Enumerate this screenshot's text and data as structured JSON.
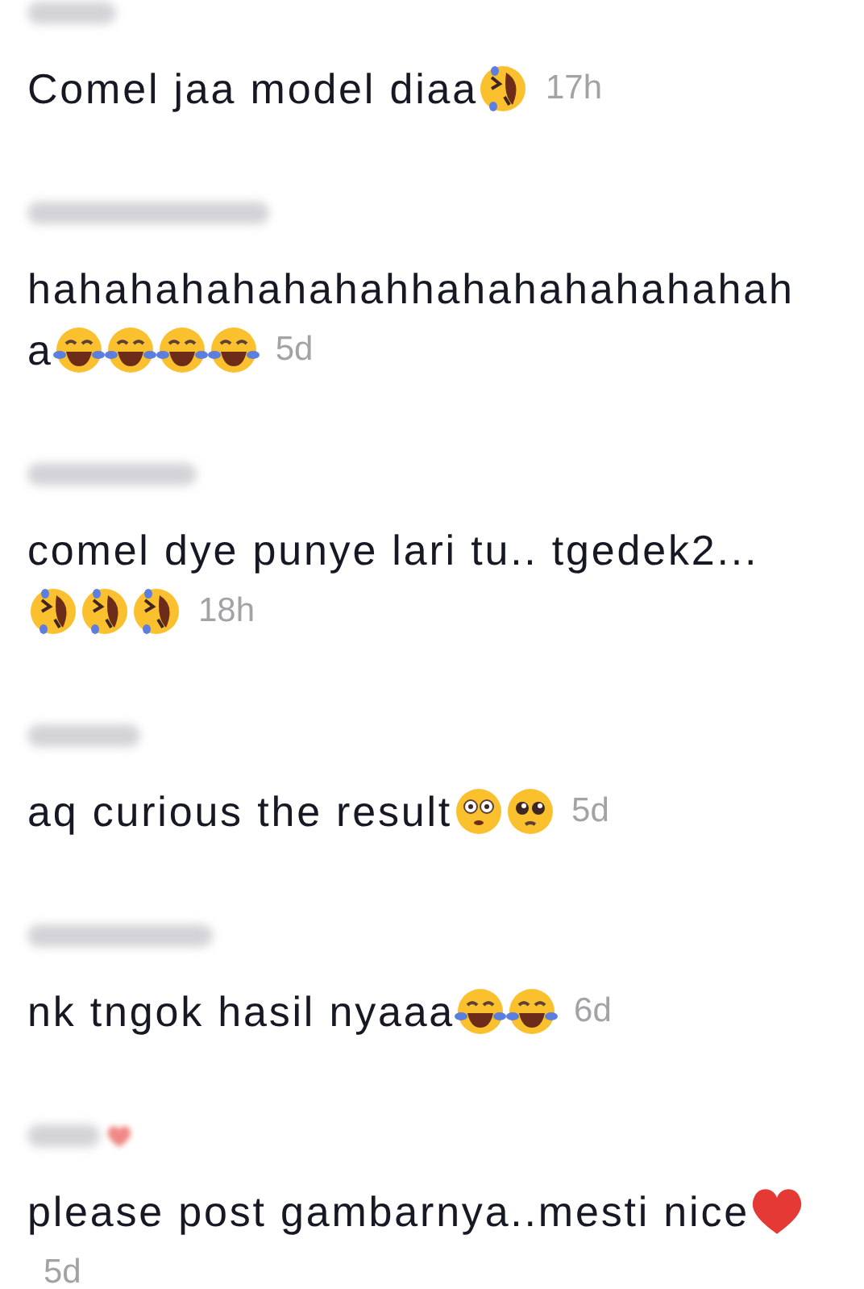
{
  "comments": [
    {
      "heart_in_name": false,
      "lines": [
        [
          {
            "kind": "text",
            "text": "Comel jaa model diaa"
          },
          {
            "kind": "rofl"
          },
          {
            "kind": "time",
            "text": "17h"
          }
        ]
      ]
    },
    {
      "heart_in_name": false,
      "lines": [
        [
          {
            "kind": "text",
            "text": "hahahahahahahahhahahahahahahah"
          }
        ],
        [
          {
            "kind": "text",
            "text": "a"
          },
          {
            "kind": "joy"
          },
          {
            "kind": "joy"
          },
          {
            "kind": "joy"
          },
          {
            "kind": "joy"
          },
          {
            "kind": "time",
            "text": "5d"
          }
        ]
      ]
    },
    {
      "heart_in_name": false,
      "lines": [
        [
          {
            "kind": "text",
            "text": "comel dye punye lari tu.. tgedek2..."
          }
        ],
        [
          {
            "kind": "rofl"
          },
          {
            "kind": "rofl"
          },
          {
            "kind": "rofl"
          },
          {
            "kind": "time",
            "text": "18h"
          }
        ]
      ]
    },
    {
      "heart_in_name": false,
      "lines": [
        [
          {
            "kind": "text",
            "text": "aq curious the result"
          },
          {
            "kind": "flushed"
          },
          {
            "kind": "pleading"
          },
          {
            "kind": "time",
            "text": "5d"
          }
        ]
      ]
    },
    {
      "heart_in_name": false,
      "lines": [
        [
          {
            "kind": "text",
            "text": "nk tngok hasil nyaaa"
          },
          {
            "kind": "joy"
          },
          {
            "kind": "joy"
          },
          {
            "kind": "time",
            "text": "6d"
          }
        ]
      ]
    },
    {
      "heart_in_name": true,
      "lines": [
        [
          {
            "kind": "text",
            "text": "please post gambarnya..mesti nice"
          },
          {
            "kind": "heart"
          }
        ],
        [
          {
            "kind": "time",
            "text": "5d"
          }
        ]
      ]
    }
  ]
}
